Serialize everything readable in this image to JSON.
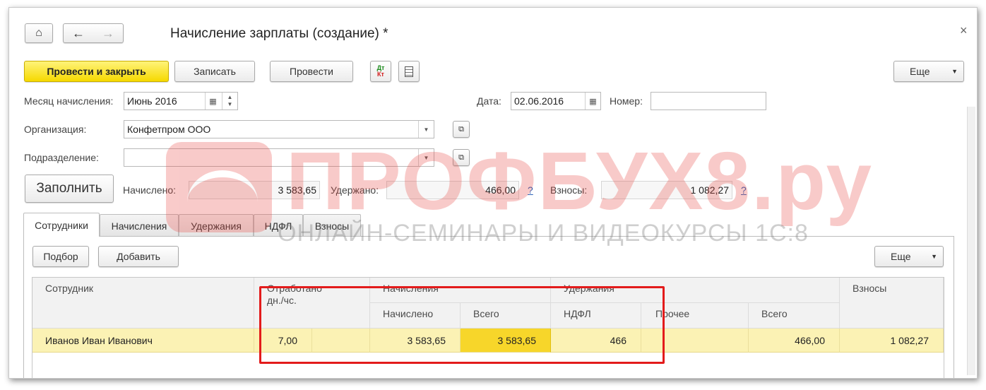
{
  "window": {
    "title": "Начисление зарплаты (создание) *",
    "close_glyph": "×"
  },
  "toolbar": {
    "post_and_close": "Провести и закрыть",
    "save": "Записать",
    "post": "Провести",
    "dtkt_top": "Дт",
    "dtkt_bottom": "Кт",
    "more": "Еще"
  },
  "form": {
    "month_label": "Месяц начисления:",
    "month_value": "Июнь 2016",
    "date_label": "Дата:",
    "date_value": "02.06.2016",
    "number_label": "Номер:",
    "number_value": "",
    "org_label": "Организация:",
    "org_value": "Конфетпром ООО",
    "dept_label": "Подразделение:",
    "dept_value": "",
    "fill_button": "Заполнить",
    "accrued_label": "Начислено:",
    "accrued_value": "3 583,65",
    "withheld_label": "Удержано:",
    "withheld_value": "466,00",
    "contrib_label": "Взносы:",
    "contrib_value": "1 082,27",
    "help": "?"
  },
  "tabs": [
    {
      "label": "Сотрудники"
    },
    {
      "label": "Начисления"
    },
    {
      "label": "Удержания"
    },
    {
      "label": "НДФЛ"
    },
    {
      "label": "Взносы"
    }
  ],
  "table_toolbar": {
    "pick": "Подбор",
    "add": "Добавить",
    "more": "Еще"
  },
  "table": {
    "headers": {
      "employee": "Сотрудник",
      "worked": "Отработано дн./чс.",
      "accruals": "Начисления",
      "accrued": "Начислено",
      "accrued_total": "Всего",
      "deductions": "Удержания",
      "ndfl": "НДФЛ",
      "other": "Прочее",
      "deductions_total": "Всего",
      "contributions": "Взносы"
    },
    "rows": [
      {
        "employee": "Иванов Иван Иванович",
        "worked_days": "7,00",
        "worked_hours": "",
        "accrued": "3 583,65",
        "accrued_total": "3 583,65",
        "ndfl": "466",
        "other": "",
        "deductions_total": "466,00",
        "contributions": "1 082,27"
      }
    ]
  },
  "watermark": {
    "brand": "ПРОФБУХ8.ру",
    "tagline": "ОНЛАЙН-СЕМИНАРЫ И ВИДЕОКУРСЫ 1С:8"
  },
  "colors": {
    "accent_yellow": "#f6d900",
    "row_highlight": "#fbf2b4",
    "active_cell": "#f7d62a",
    "annotation_red": "#e31b1b",
    "watermark_red": "#e8463f"
  }
}
